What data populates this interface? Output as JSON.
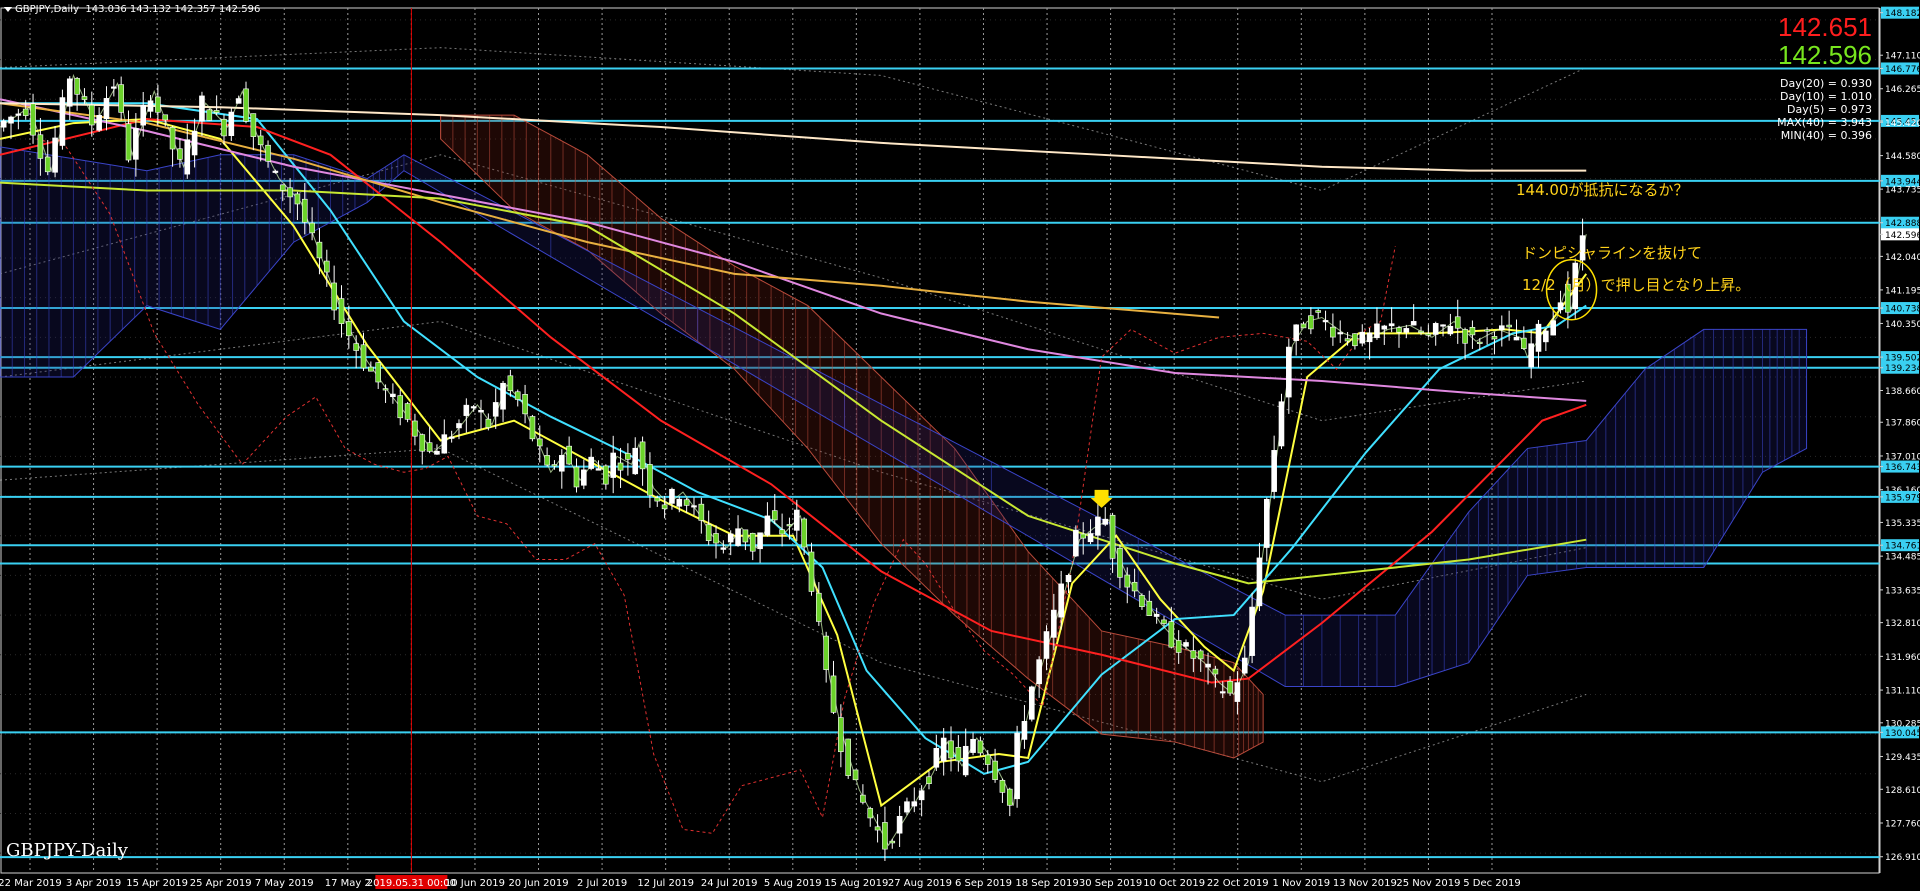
{
  "window": {
    "symbol_timeframe": "GBPJPY,Daily",
    "ohlc": "143.036 143.132 142.357 142.596",
    "watermark": "GBPJPY-Daily"
  },
  "prices": {
    "ask": "142.651",
    "bid": "142.596",
    "ask_color": "#ff1e1e",
    "bid_color": "#78e61e"
  },
  "stats": [
    "Day(20) = 0.930",
    "Day(10) = 1.010",
    "Day(5) = 0.973",
    "MAX(40) = 3.943",
    "MIN(40) = 0.396"
  ],
  "annotations": {
    "resistance_question": "144.00が抵抗になるか？",
    "breakout_line1": "ドンピシャラインを抜けて",
    "breakout_line2": "12/2（月）で押し目となり上昇。"
  },
  "chart_data": {
    "type": "candlestick",
    "symbol": "GBPJPY",
    "timeframe": "Daily",
    "ylim": [
      126.4,
      148.4
    ],
    "yticks": [
      "148.182",
      "147.110",
      "146.776",
      "146.265",
      "145.454",
      "145.420",
      "144.580",
      "143.944",
      "143.735",
      "142.888",
      "142.596",
      "142.040",
      "141.195",
      "140.738",
      "140.350",
      "139.502",
      "139.234",
      "138.660",
      "137.860",
      "137.010",
      "136.743",
      "136.160",
      "135.979",
      "135.335",
      "134.761",
      "134.485",
      "133.635",
      "132.810",
      "131.960",
      "131.110",
      "130.285",
      "130.045",
      "129.435",
      "128.610",
      "127.760",
      "126.910"
    ],
    "price_boxes": [
      "148.182",
      "146.776",
      "145.454",
      "143.944",
      "142.888",
      "140.738",
      "139.502",
      "139.234",
      "136.743",
      "135.979",
      "134.761",
      "130.045"
    ],
    "current_price_label": "142.596",
    "xlabels": [
      "22 Mar 2019",
      "3 Apr 2019",
      "15 Apr 2019",
      "25 Apr 2019",
      "7 May 2019",
      "17 May 2",
      "2019.05.31 00:00",
      "10 Jun 2019",
      "20 Jun 2019",
      "2 Jul 2019",
      "12 Jul 2019",
      "24 Jul 2019",
      "5 Aug 2019",
      "15 Aug 2019",
      "27 Aug 2019",
      "6 Sep 2019",
      "18 Sep 2019",
      "30 Sep 2019",
      "10 Oct 2019",
      "22 Oct 2019",
      "1 Nov 2019",
      "13 Nov 2019",
      "25 Nov 2019",
      "5 Dec 2019"
    ],
    "horizontal_levels": [
      146.776,
      145.454,
      143.944,
      142.888,
      140.738,
      139.502,
      139.234,
      136.743,
      135.979,
      134.761,
      134.3,
      130.045,
      126.9
    ],
    "price_path": [
      [
        0,
        145.3
      ],
      [
        4,
        145.8
      ],
      [
        7,
        144.2
      ],
      [
        10,
        146.6
      ],
      [
        13,
        145.4
      ],
      [
        16,
        146.4
      ],
      [
        18,
        144.6
      ],
      [
        21,
        146.2
      ],
      [
        25,
        144.3
      ],
      [
        28,
        145.9
      ],
      [
        31,
        145.3
      ],
      [
        33,
        146.2
      ],
      [
        35,
        145.1
      ],
      [
        38,
        144.0
      ],
      [
        41,
        143.4
      ],
      [
        44,
        141.9
      ],
      [
        47,
        140.4
      ],
      [
        50,
        139.4
      ],
      [
        53,
        138.6
      ],
      [
        56,
        137.9
      ],
      [
        59,
        137.1
      ],
      [
        62,
        137.6
      ],
      [
        65,
        138.3
      ],
      [
        67,
        137.8
      ],
      [
        69,
        138.8
      ],
      [
        71,
        138.4
      ],
      [
        73,
        137.5
      ],
      [
        75,
        136.6
      ],
      [
        77,
        137.1
      ],
      [
        79,
        136.4
      ],
      [
        81,
        136.9
      ],
      [
        83,
        136.5
      ],
      [
        84,
        137.0
      ],
      [
        86,
        136.8
      ],
      [
        87,
        137.3
      ],
      [
        89,
        136.2
      ],
      [
        91,
        135.8
      ],
      [
        93,
        136.1
      ],
      [
        95,
        135.6
      ],
      [
        97,
        135.0
      ],
      [
        99,
        134.7
      ],
      [
        101,
        135.2
      ],
      [
        103,
        134.7
      ],
      [
        105,
        135.4
      ],
      [
        107,
        135.1
      ],
      [
        109,
        135.5
      ],
      [
        111,
        133.8
      ],
      [
        113,
        131.4
      ],
      [
        115,
        129.8
      ],
      [
        117,
        128.6
      ],
      [
        119,
        127.9
      ],
      [
        121,
        127.2
      ],
      [
        123,
        127.8
      ],
      [
        125,
        128.4
      ],
      [
        127,
        129.0
      ],
      [
        129,
        129.8
      ],
      [
        131,
        129.2
      ],
      [
        133,
        129.9
      ],
      [
        135,
        129.4
      ],
      [
        137,
        128.7
      ],
      [
        138,
        128.2
      ],
      [
        139,
        129.8
      ],
      [
        141,
        131.2
      ],
      [
        143,
        132.4
      ],
      [
        145,
        133.6
      ],
      [
        147,
        134.9
      ],
      [
        149,
        135.2
      ],
      [
        151,
        135.4
      ],
      [
        152,
        134.6
      ],
      [
        154,
        133.8
      ],
      [
        156,
        133.4
      ],
      [
        158,
        132.8
      ],
      [
        160,
        132.4
      ],
      [
        162,
        132.1
      ],
      [
        164,
        131.8
      ],
      [
        166,
        131.3
      ],
      [
        168,
        131.0
      ],
      [
        170,
        131.8
      ],
      [
        172,
        134.6
      ],
      [
        174,
        137.2
      ],
      [
        176,
        139.8
      ],
      [
        178,
        140.4
      ],
      [
        180,
        140.5
      ],
      [
        183,
        140.1
      ],
      [
        186,
        139.9
      ],
      [
        189,
        140.2
      ],
      [
        192,
        140.3
      ],
      [
        195,
        140.0
      ],
      [
        198,
        140.4
      ],
      [
        201,
        139.9
      ],
      [
        204,
        140.2
      ],
      [
        207,
        140.0
      ],
      [
        208,
        139.5
      ],
      [
        210,
        140.1
      ],
      [
        212,
        140.5
      ],
      [
        213,
        141.1
      ],
      [
        214,
        140.7
      ],
      [
        215,
        141.7
      ],
      [
        216,
        142.6
      ]
    ],
    "indicators": [
      {
        "color": "#ffff40",
        "values": [
          [
            0,
            145.0
          ],
          [
            10,
            145.4
          ],
          [
            20,
            145.5
          ],
          [
            30,
            145.0
          ],
          [
            40,
            142.8
          ],
          [
            50,
            139.8
          ],
          [
            60,
            137.4
          ],
          [
            70,
            137.9
          ],
          [
            80,
            136.9
          ],
          [
            90,
            135.9
          ],
          [
            100,
            135.0
          ],
          [
            108,
            135.0
          ],
          [
            114,
            132.5
          ],
          [
            120,
            128.2
          ],
          [
            128,
            129.3
          ],
          [
            136,
            129.5
          ],
          [
            140,
            129.4
          ],
          [
            146,
            133.8
          ],
          [
            152,
            135.0
          ],
          [
            158,
            133.4
          ],
          [
            164,
            132.2
          ],
          [
            168,
            131.6
          ],
          [
            172,
            133.6
          ],
          [
            178,
            139.0
          ],
          [
            185,
            140.1
          ],
          [
            195,
            140.1
          ],
          [
            205,
            140.2
          ],
          [
            210,
            140.1
          ],
          [
            216,
            141.6
          ]
        ]
      },
      {
        "color": "#40e0ff",
        "values": [
          [
            0,
            145.9
          ],
          [
            20,
            145.9
          ],
          [
            35,
            145.5
          ],
          [
            45,
            143.2
          ],
          [
            55,
            140.4
          ],
          [
            65,
            139.0
          ],
          [
            75,
            138.0
          ],
          [
            85,
            137.1
          ],
          [
            95,
            136.1
          ],
          [
            105,
            135.4
          ],
          [
            112,
            134.2
          ],
          [
            118,
            131.6
          ],
          [
            126,
            129.9
          ],
          [
            134,
            129.0
          ],
          [
            140,
            129.3
          ],
          [
            150,
            131.5
          ],
          [
            160,
            132.9
          ],
          [
            168,
            133.0
          ],
          [
            176,
            134.7
          ],
          [
            186,
            137.1
          ],
          [
            196,
            139.2
          ],
          [
            206,
            140.1
          ],
          [
            212,
            140.3
          ],
          [
            216,
            140.8
          ]
        ]
      },
      {
        "color": "#ff2020",
        "values": [
          [
            0,
            144.6
          ],
          [
            20,
            145.5
          ],
          [
            35,
            145.3
          ],
          [
            45,
            144.6
          ],
          [
            60,
            142.4
          ],
          [
            75,
            140.0
          ],
          [
            90,
            137.9
          ],
          [
            105,
            136.3
          ],
          [
            120,
            134.1
          ],
          [
            135,
            132.6
          ],
          [
            150,
            132.0
          ],
          [
            165,
            131.3
          ],
          [
            170,
            131.4
          ],
          [
            180,
            132.8
          ],
          [
            195,
            135.1
          ],
          [
            210,
            137.9
          ],
          [
            216,
            138.3
          ]
        ]
      },
      {
        "color": "#e088e0",
        "values": [
          [
            0,
            146.0
          ],
          [
            20,
            145.2
          ],
          [
            40,
            144.3
          ],
          [
            60,
            143.6
          ],
          [
            80,
            142.9
          ],
          [
            100,
            141.9
          ],
          [
            120,
            140.6
          ],
          [
            140,
            139.7
          ],
          [
            160,
            139.1
          ],
          [
            180,
            138.9
          ],
          [
            200,
            138.6
          ],
          [
            216,
            138.4
          ]
        ]
      },
      {
        "color": "#e8b040",
        "values": [
          [
            0,
            145.9
          ],
          [
            20,
            145.4
          ],
          [
            40,
            144.5
          ],
          [
            60,
            143.4
          ],
          [
            80,
            142.4
          ],
          [
            100,
            141.6
          ],
          [
            120,
            141.3
          ],
          [
            140,
            140.9
          ],
          [
            166,
            140.5
          ]
        ]
      },
      {
        "color": "#ffe8c8",
        "values": [
          [
            0,
            145.9
          ],
          [
            30,
            145.8
          ],
          [
            60,
            145.6
          ],
          [
            90,
            145.3
          ],
          [
            120,
            144.9
          ],
          [
            150,
            144.6
          ],
          [
            180,
            144.3
          ],
          [
            200,
            144.2
          ],
          [
            216,
            144.2
          ]
        ]
      },
      {
        "color": "#c8e832",
        "values": [
          [
            0,
            143.9
          ],
          [
            20,
            143.7
          ],
          [
            40,
            143.7
          ],
          [
            60,
            143.5
          ],
          [
            80,
            142.8
          ],
          [
            100,
            140.6
          ],
          [
            120,
            137.9
          ],
          [
            140,
            135.5
          ],
          [
            160,
            134.3
          ],
          [
            170,
            133.8
          ],
          [
            185,
            134.1
          ],
          [
            200,
            134.4
          ],
          [
            216,
            134.9
          ]
        ]
      }
    ],
    "ichimoku_cloud_red": [
      [
        60,
        145.6,
        145.0
      ],
      [
        70,
        145.6,
        143.2
      ],
      [
        80,
        144.6,
        142.2
      ],
      [
        90,
        143.0,
        140.6
      ],
      [
        100,
        141.8,
        139.2
      ],
      [
        110,
        140.8,
        137.2
      ],
      [
        120,
        139.0,
        134.8
      ],
      [
        130,
        137.2,
        133.0
      ],
      [
        140,
        134.6,
        131.4
      ],
      [
        150,
        132.6,
        130.0
      ],
      [
        160,
        132.2,
        129.8
      ],
      [
        168,
        131.8,
        129.4
      ],
      [
        172,
        131.0,
        129.8
      ]
    ],
    "ichimoku_cloud_blue": [
      [
        0,
        144.8,
        139.0
      ],
      [
        10,
        144.5,
        139.0
      ],
      [
        20,
        144.2,
        140.8
      ],
      [
        30,
        144.6,
        140.2
      ],
      [
        40,
        144.6,
        142.4
      ],
      [
        50,
        144.0,
        143.4
      ],
      [
        55,
        144.6,
        144.2
      ],
      [
        175,
        133.0,
        131.2
      ],
      [
        190,
        133.0,
        131.2
      ],
      [
        200,
        135.6,
        131.8
      ],
      [
        208,
        137.2,
        134.0
      ],
      [
        216,
        137.4,
        134.2
      ],
      [
        224,
        139.2,
        134.2
      ],
      [
        232,
        140.2,
        134.2
      ],
      [
        240,
        140.2,
        136.6
      ],
      [
        246,
        140.2,
        137.2
      ]
    ]
  }
}
